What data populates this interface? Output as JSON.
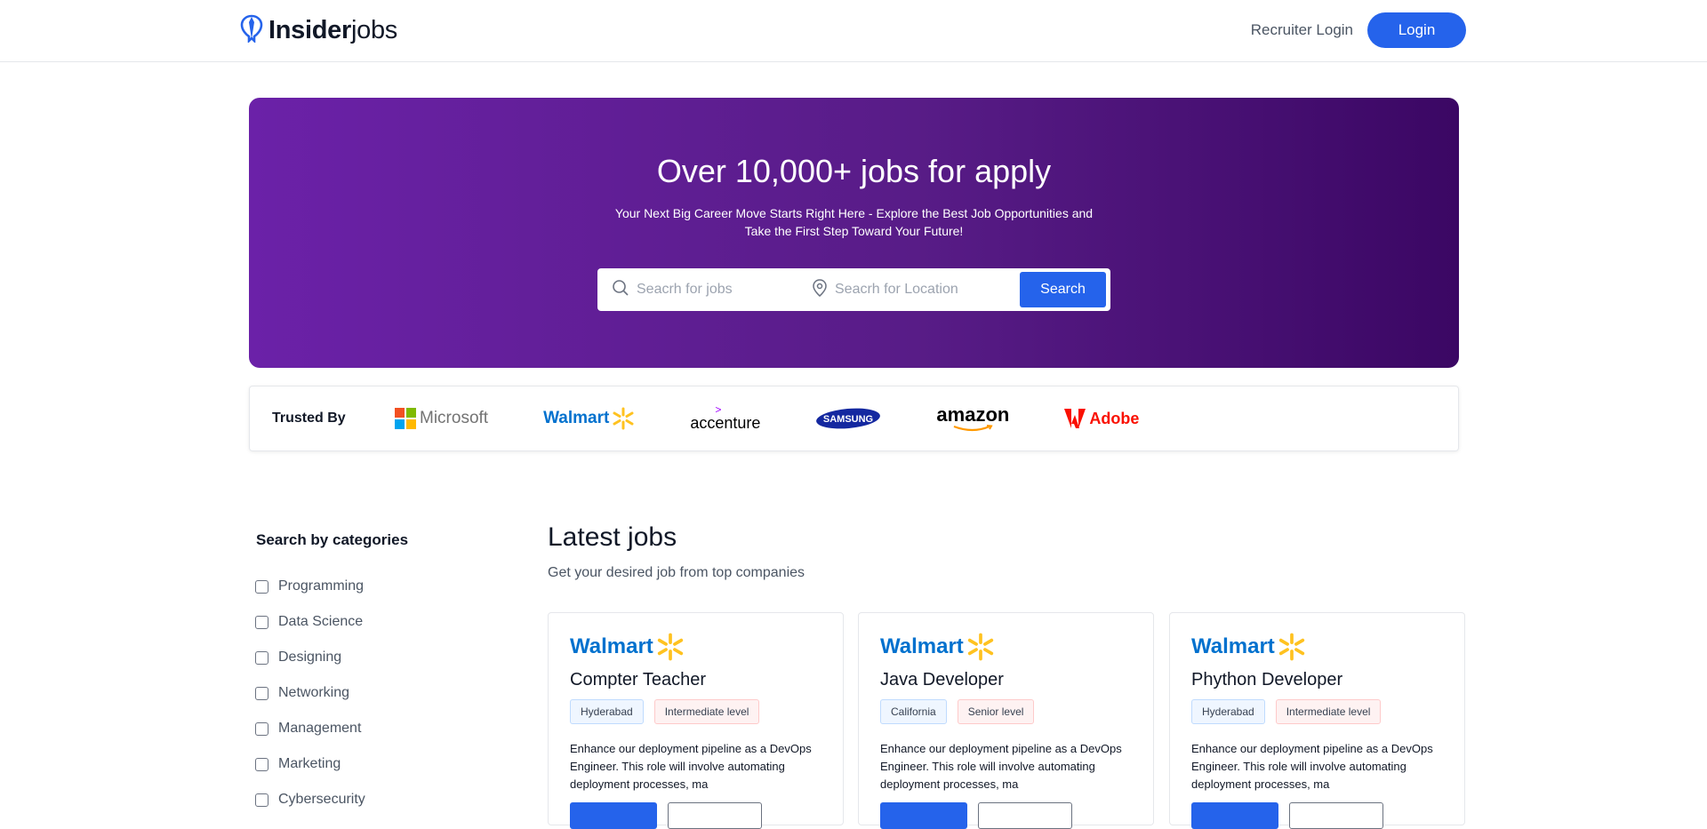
{
  "navbar": {
    "logo_bold": "Insider",
    "logo_light": "jobs",
    "recruiter_login": "Recruiter Login",
    "login": "Login"
  },
  "hero": {
    "title": "Over 10,000+ jobs for apply",
    "subtitle": "Your Next Big Career Move Starts Right Here - Explore the Best Job Opportunities and Take the First Step Toward Your Future!",
    "search_jobs_placeholder": "Seacrh for jobs",
    "search_location_placeholder": "Seacrh for Location",
    "search_button": "Search"
  },
  "trusted": {
    "label": "Trusted By",
    "brands": [
      "Microsoft",
      "Walmart",
      "accenture",
      "SAMSUNG",
      "amazon",
      "Adobe"
    ]
  },
  "categories": {
    "title": "Search by categories",
    "items": [
      "Programming",
      "Data Science",
      "Designing",
      "Networking",
      "Management",
      "Marketing",
      "Cybersecurity"
    ]
  },
  "latest": {
    "title": "Latest jobs",
    "subtitle": "Get your desired job from top companies",
    "jobs": [
      {
        "company": "Walmart",
        "title": "Compter Teacher",
        "location": "Hyderabad",
        "level": "Intermediate level",
        "description": "Enhance our deployment pipeline as a DevOps Engineer. This role will involve automating deployment processes, ma"
      },
      {
        "company": "Walmart",
        "title": "Java Developer",
        "location": "California",
        "level": "Senior level",
        "description": "Enhance our deployment pipeline as a DevOps Engineer. This role will involve automating deployment processes, ma"
      },
      {
        "company": "Walmart",
        "title": "Phython Developer",
        "location": "Hyderabad",
        "level": "Intermediate level",
        "description": "Enhance our deployment pipeline as a DevOps Engineer. This role will involve automating deployment processes, ma"
      }
    ]
  },
  "colors": {
    "primary": "#2563eb",
    "hero_start": "#6b21a8",
    "hero_end": "#3b0764",
    "walmart_blue": "#0071ce",
    "walmart_yellow": "#ffc220",
    "adobe_red": "#fa0f00"
  }
}
